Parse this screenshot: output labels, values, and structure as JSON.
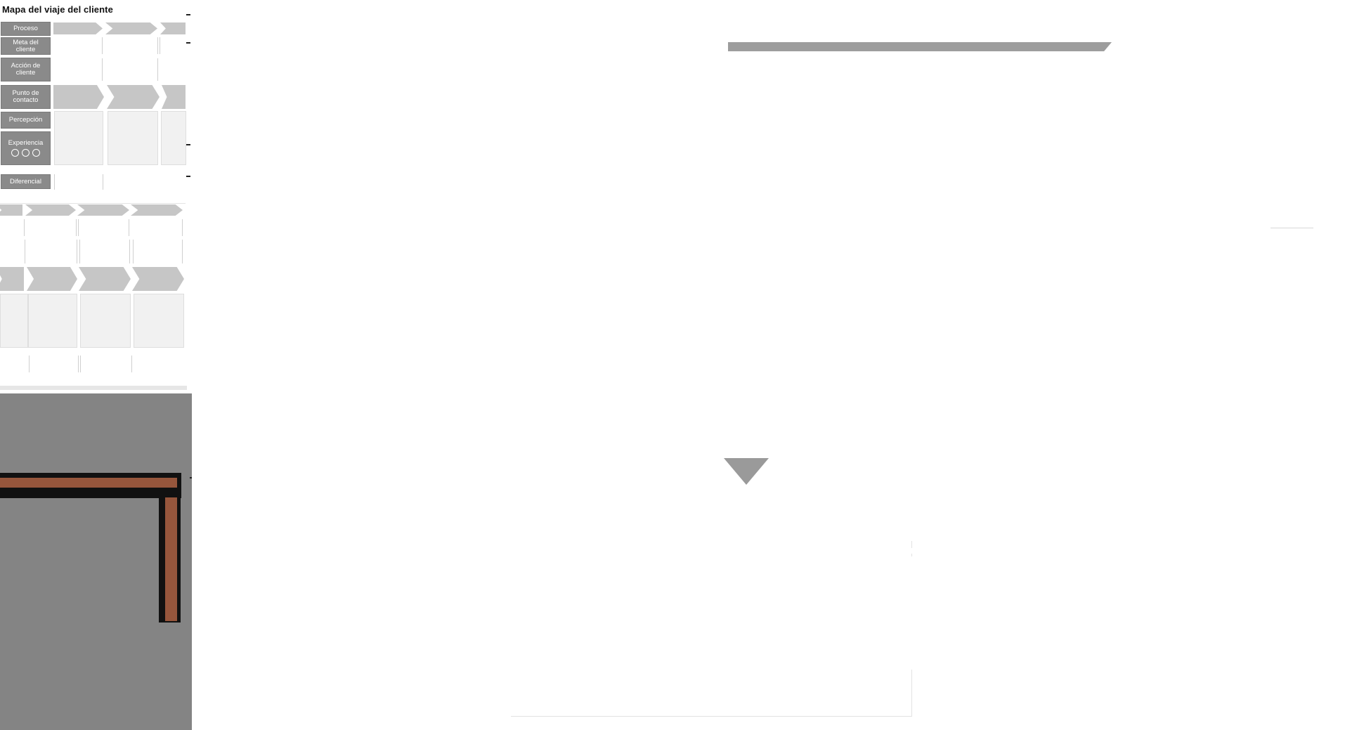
{
  "template": {
    "title": "Mapa del viaje del cliente",
    "rows": {
      "proceso": "Proceso",
      "meta": "Meta del cliente",
      "accion": "Acción de cliente",
      "punto": "Punto de contacto",
      "percepcion": "Percepción",
      "experiencia": "Experiencia",
      "diferencial": "Diferencial"
    }
  },
  "colors": {
    "label_bg": "#8a8a8a",
    "chevron": "#c6c6c6",
    "cell_grey": "#f1f1f1",
    "backdrop": "#848484",
    "frame_wood": "#96563c",
    "frame_shadow": "#111111"
  },
  "icons": {
    "experience_faces": [
      "happy-face-icon",
      "neutral-face-icon",
      "sad-face-icon"
    ]
  }
}
